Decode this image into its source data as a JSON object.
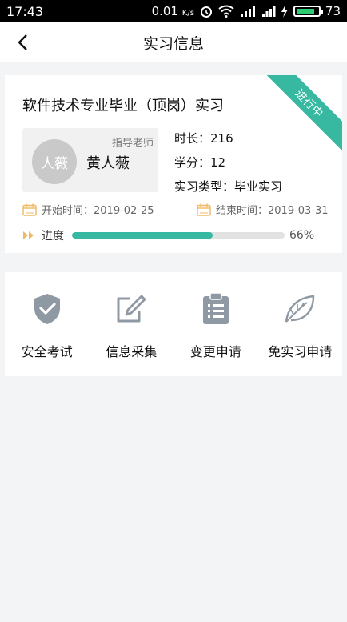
{
  "status_bar": {
    "time": "17:43",
    "speed": "0.01",
    "speed_unit": "K/s",
    "battery": "73"
  },
  "header": {
    "title": "实习信息"
  },
  "internship": {
    "title": "软件技术专业毕业（顶岗）实习",
    "status_ribbon": "进行中",
    "teacher_tag": "指导老师",
    "teacher_avatar_text": "人薇",
    "teacher_name": "黄人薇",
    "duration": "时长：216",
    "credits": "学分：12",
    "type": "实习类型：毕业实习",
    "start_date": "开始时间：2019-02-25",
    "end_date": "结束时间：2019-03-31",
    "progress_label": "进度",
    "progress_text": "66%",
    "progress_value": 0.66
  },
  "actions": [
    {
      "label": "安全考试",
      "icon": "shield-check-icon"
    },
    {
      "label": "信息采集",
      "icon": "edit-icon"
    },
    {
      "label": "变更申请",
      "icon": "clipboard-list-icon"
    },
    {
      "label": "免实习申请",
      "icon": "leaf-icon"
    }
  ],
  "colors": {
    "accent": "#36b9a0",
    "icon_gray": "#8e99a4",
    "date_icon": "#f0b860"
  }
}
